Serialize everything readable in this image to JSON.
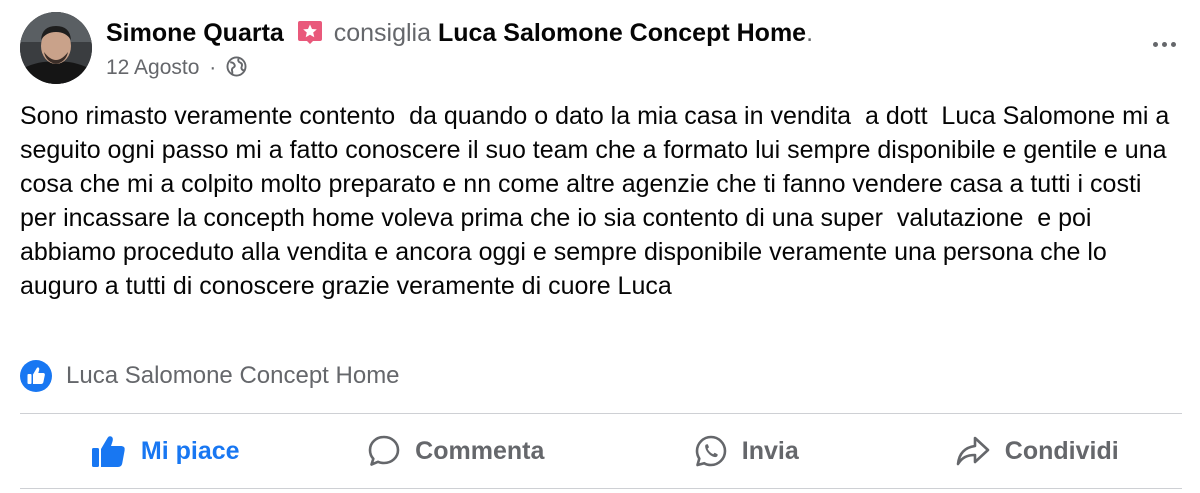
{
  "post": {
    "author": "Simone Quarta",
    "recommends_text": "consiglia",
    "page_name": "Luca Salomone Concept Home",
    "date": "12 Agosto",
    "separator": "·",
    "body": "Sono rimasto veramente contento  da quando o dato la mia casa in vendita  a dott  Luca Salomone mi a seguito ogni passo mi a fatto conoscere il suo team che a formato lui sempre disponibile e gentile e una cosa che mi a colpito molto preparato e nn come altre agenzie che ti fanno vendere casa a tutti i costi per incassare la concepth home voleva prima che io sia contento di una super  valutazione  e poi abbiamo proceduto alla vendita e ancora oggi e sempre disponibile veramente una persona che lo auguro a tutti di conoscere grazie veramente di cuore Luca",
    "liked_by": "Luca Salomone Concept Home",
    "audience_icon": "globe-icon",
    "recommendation_icon": "recommendation-star-icon"
  },
  "actions": {
    "like": "Mi piace",
    "comment": "Commenta",
    "send": "Invia",
    "share": "Condividi"
  },
  "colors": {
    "accent": "#1877f2",
    "recommend_badge": "#e9597b",
    "secondary_text": "#65676b",
    "divider": "#ced0d4"
  }
}
